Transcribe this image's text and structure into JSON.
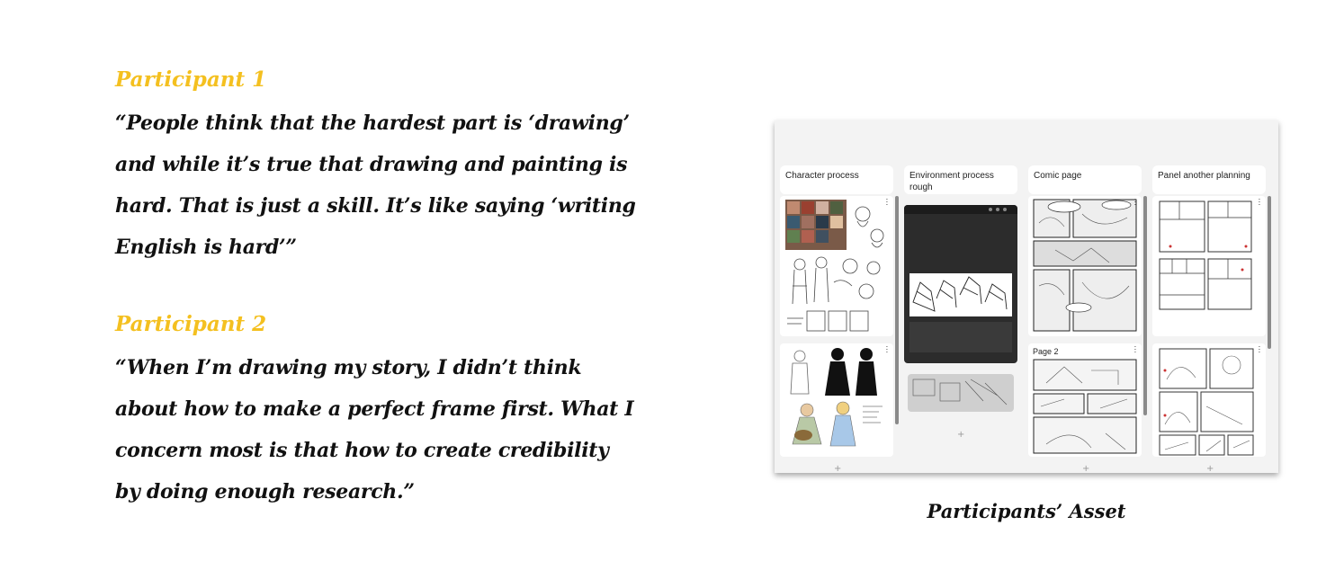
{
  "participants": [
    {
      "label": "Participant 1",
      "quote_lines": [
        "“People think that the hardest part is ‘drawing’",
        "and while it’s true that drawing and painting is",
        "hard. That is just a skill. It’s like saying ‘writing",
        "English is hard’”"
      ]
    },
    {
      "label": "Participant 2",
      "quote_lines": [
        "“When I’m drawing my story, I didn’t think",
        "about how to make a perfect frame first. What I",
        "concern most is that how to create credibility",
        "by doing enough research.”"
      ]
    }
  ],
  "board": {
    "columns": [
      {
        "title": "Character process"
      },
      {
        "title": "Environment process rough"
      },
      {
        "title": "Comic page"
      },
      {
        "title": "Panel another planning"
      }
    ],
    "page2_label": "Page 2",
    "add_symbol": "+",
    "menu_symbol": "⋯"
  },
  "caption": "Participants’ Asset",
  "colors": {
    "accent": "#f4c020",
    "text": "#111111"
  }
}
